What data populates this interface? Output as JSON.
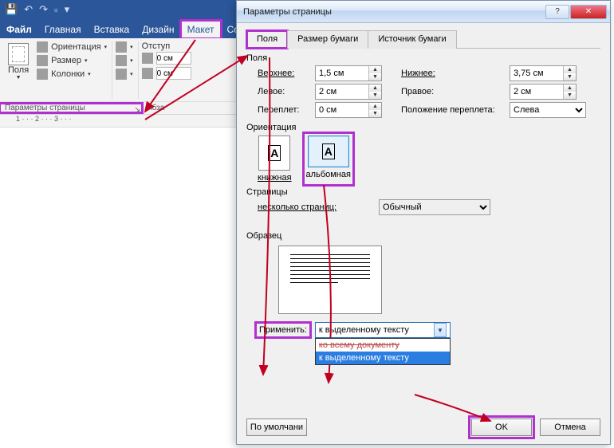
{
  "word": {
    "qat_icons": [
      "save",
      "undo",
      "redo",
      "new",
      "expand"
    ],
    "tabs": {
      "file": "Файл",
      "home": "Главная",
      "insert": "Вставка",
      "design": "Дизайн",
      "layout": "Макет",
      "refs": "Ссы"
    },
    "ribbon": {
      "margins": "Поля",
      "orientation": "Ориентация",
      "size": "Размер",
      "columns": "Колонки",
      "indent_label": "Отступ",
      "indent_val": "0 см",
      "section_page": "Параметры страницы",
      "section_par": "Абза"
    },
    "ruler": "1 · · · 2 · · · 3 · · ·"
  },
  "dialog": {
    "title": "Параметры страницы",
    "caps": {
      "help": "?",
      "close": "✕"
    },
    "tabs": {
      "fields": "Поля",
      "paper": "Размер бумаги",
      "source": "Источник бумаги"
    },
    "fields_group": "Поля",
    "top_label": "Верхнее:",
    "top_val": "1,5 см",
    "bottom_label": "Нижнее:",
    "bottom_val": "3,75 см",
    "left_label": "Левое:",
    "left_val": "2 см",
    "right_label": "Правое:",
    "right_val": "2 см",
    "gutter_label": "Переплет:",
    "gutter_val": "0 см",
    "gutter_pos_label": "Положение переплета:",
    "gutter_pos_val": "Слева",
    "orient_group": "Ориентация",
    "orient_portrait": "книжная",
    "orient_landscape": "альбомная",
    "pages_group": "Страницы",
    "multi_pages_label": "несколько страниц:",
    "multi_pages_val": "Обычный",
    "preview_group": "Образец",
    "apply_label": "Применить:",
    "apply_selected": "к выделенному тексту",
    "apply_opt_all": "ко всему документу",
    "apply_opt_sel": "к выделенному тексту",
    "default_btn": "По умолчани",
    "ok": "OK",
    "cancel": "Отмена"
  }
}
